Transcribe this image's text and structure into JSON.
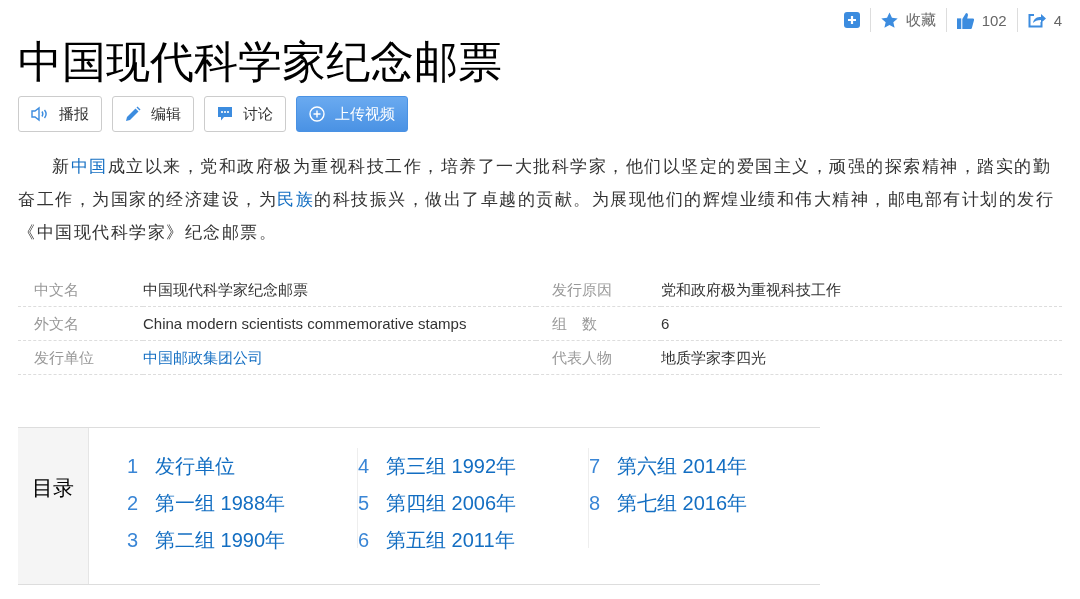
{
  "toolbar": {
    "favorite": "收藏",
    "likes": "102",
    "shares": "4"
  },
  "title": "中国现代科学家纪念邮票",
  "actions": [
    {
      "kind": "speaker",
      "label": "播报"
    },
    {
      "kind": "pencil",
      "label": "编辑"
    },
    {
      "kind": "chat",
      "label": "讨论"
    },
    {
      "kind": "upload",
      "label": "上传视频"
    }
  ],
  "summary": [
    {
      "text": "新"
    },
    {
      "text": "中国",
      "kind": "link"
    },
    {
      "text": "成立以来，党和政府极为重视科技工作，培养了一大批科学家，他们以坚定的爱国主义，顽强的探索精神，踏实的勤奋工作，为国家的经济建设，为"
    },
    {
      "text": "民族",
      "kind": "link"
    },
    {
      "text": "的科技振兴，做出了卓越的贡献。为展现他们的辉煌业绩和伟大精神，邮电部有计划的发行《中国现代科学家》纪念邮票。"
    }
  ],
  "info": [
    {
      "label": "中文名",
      "value": "中国现代科学家纪念邮票"
    },
    {
      "label": "发行原因",
      "value": "党和政府极为重视科技工作"
    },
    {
      "label": "外文名",
      "value": "China modern scientists commemorative stamps"
    },
    {
      "label": "组　数",
      "value": "6"
    },
    {
      "label": "发行单位",
      "value": "中国邮政集团公司",
      "kind": "link"
    },
    {
      "label": "代表人物",
      "value": "地质学家李四光"
    }
  ],
  "toc": {
    "heading": "目录",
    "columns": [
      [
        {
          "number": "1",
          "text": "发行单位"
        },
        {
          "number": "2",
          "text": "第一组 1988年"
        },
        {
          "number": "3",
          "text": "第二组 1990年"
        }
      ],
      [
        {
          "number": "4",
          "text": "第三组 1992年"
        },
        {
          "number": "5",
          "text": "第四组 2006年"
        },
        {
          "number": "6",
          "text": "第五组 2011年"
        }
      ],
      [
        {
          "number": "7",
          "text": "第六组 2014年"
        },
        {
          "number": "8",
          "text": "第七组 2016年"
        }
      ]
    ]
  }
}
